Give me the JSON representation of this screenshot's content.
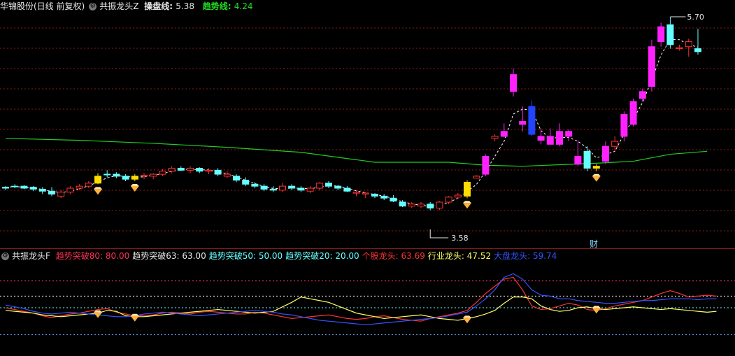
{
  "top": {
    "stock": "华锦股份(日线 前复权)",
    "indicator": "共振龙头Z",
    "cp_label": "操盘线: ",
    "cp_value": "5.38",
    "trend_label": "趋势线: ",
    "trend_value": "4.24",
    "high_mark": "5.70",
    "low_mark": "3.58",
    "fin_label": "财"
  },
  "bottom": {
    "indicator": "共振龙头F",
    "items": [
      {
        "label": "趋势突破80: ",
        "value": "80.00",
        "color": "#ff3355"
      },
      {
        "label": "趋势突破63: ",
        "value": "63.00",
        "color": "#e6e6e6"
      },
      {
        "label": "趋势突破50: ",
        "value": "50.00",
        "color": "#66ffff"
      },
      {
        "label": "趋势突破20: ",
        "value": "20.00",
        "color": "#66ffff"
      },
      {
        "label": "个股龙头: ",
        "value": "63.69",
        "color": "#ff3333"
      },
      {
        "label": "行业龙头: ",
        "value": "47.52",
        "color": "#ffff66"
      },
      {
        "label": "大盘龙头: ",
        "value": "59.74",
        "color": "#3355ff"
      }
    ]
  },
  "colors": {
    "up": "#ff3333",
    "down": "#66ffff",
    "magenta": "#ff22ff",
    "yellow": "#ffdd00",
    "blue": "#2244ff",
    "ma": "#22cc22",
    "cp": "#ffffff",
    "grid": "#8b1a1a"
  },
  "chart_data": {
    "type": "candlestick",
    "candles": [
      [
        3.98,
        4.0,
        3.96,
        3.99,
        "down"
      ],
      [
        4.0,
        4.02,
        3.98,
        4.0,
        "down"
      ],
      [
        4.0,
        4.01,
        3.97,
        3.98,
        "down"
      ],
      [
        3.99,
        4.0,
        3.95,
        3.97,
        "down"
      ],
      [
        3.97,
        3.99,
        3.92,
        3.95,
        "down"
      ],
      [
        3.95,
        3.99,
        3.9,
        3.92,
        "down"
      ],
      [
        3.9,
        3.96,
        3.88,
        3.94,
        "up"
      ],
      [
        3.94,
        4.0,
        3.92,
        3.98,
        "up"
      ],
      [
        3.98,
        4.02,
        3.96,
        4.0,
        "up"
      ],
      [
        4.0,
        4.05,
        3.98,
        4.03,
        "up"
      ],
      [
        4.03,
        4.13,
        4.02,
        4.1,
        "yellow"
      ],
      [
        4.12,
        4.16,
        4.09,
        4.12,
        "down"
      ],
      [
        4.12,
        4.14,
        4.08,
        4.1,
        "down"
      ],
      [
        4.1,
        4.12,
        4.05,
        4.07,
        "down"
      ],
      [
        4.07,
        4.12,
        4.05,
        4.1,
        "yellow"
      ],
      [
        4.1,
        4.13,
        4.07,
        4.11,
        "up"
      ],
      [
        4.1,
        4.13,
        4.07,
        4.12,
        "up"
      ],
      [
        4.12,
        4.17,
        4.1,
        4.15,
        "up"
      ],
      [
        4.15,
        4.2,
        4.13,
        4.18,
        "up"
      ],
      [
        4.18,
        4.2,
        4.15,
        4.16,
        "down"
      ],
      [
        4.16,
        4.2,
        4.13,
        4.18,
        "up"
      ],
      [
        4.18,
        4.19,
        4.13,
        4.15,
        "down"
      ],
      [
        4.15,
        4.18,
        4.12,
        4.16,
        "up"
      ],
      [
        4.16,
        4.18,
        4.1,
        4.12,
        "down"
      ],
      [
        4.12,
        4.15,
        4.08,
        4.1,
        "up"
      ],
      [
        4.1,
        4.12,
        4.04,
        4.06,
        "down"
      ],
      [
        4.06,
        4.09,
        4.0,
        4.02,
        "down"
      ],
      [
        4.02,
        4.04,
        3.98,
        4.0,
        "down"
      ],
      [
        4.0,
        4.02,
        3.95,
        3.97,
        "down"
      ],
      [
        3.97,
        4.0,
        3.94,
        3.96,
        "down"
      ],
      [
        3.96,
        4.03,
        3.94,
        4.0,
        "up"
      ],
      [
        4.0,
        4.02,
        3.96,
        3.98,
        "down"
      ],
      [
        3.98,
        4.0,
        3.94,
        3.96,
        "down"
      ],
      [
        3.95,
        4.0,
        3.93,
        3.98,
        "up"
      ],
      [
        3.98,
        4.04,
        3.96,
        4.03,
        "up"
      ],
      [
        4.03,
        4.05,
        3.98,
        4.0,
        "down"
      ],
      [
        4.0,
        4.01,
        3.96,
        3.98,
        "down"
      ],
      [
        3.98,
        4.0,
        3.94,
        3.95,
        "down"
      ],
      [
        3.94,
        3.96,
        3.9,
        3.93,
        "up"
      ],
      [
        3.93,
        3.94,
        3.88,
        3.92,
        "up"
      ],
      [
        3.92,
        3.93,
        3.88,
        3.9,
        "down"
      ],
      [
        3.9,
        3.92,
        3.86,
        3.88,
        "down"
      ],
      [
        3.88,
        3.91,
        3.84,
        3.85,
        "down"
      ],
      [
        3.84,
        3.86,
        3.79,
        3.8,
        "down"
      ],
      [
        3.8,
        3.84,
        3.78,
        3.82,
        "up"
      ],
      [
        3.82,
        3.84,
        3.78,
        3.8,
        "up"
      ],
      [
        3.82,
        3.84,
        3.76,
        3.78,
        "down"
      ],
      [
        3.78,
        3.85,
        3.76,
        3.84,
        "up"
      ],
      [
        3.84,
        3.9,
        3.82,
        3.89,
        "up"
      ],
      [
        3.89,
        3.93,
        3.87,
        3.91,
        "up"
      ],
      [
        3.9,
        4.06,
        3.88,
        4.04,
        "yellow"
      ],
      [
        4.08,
        4.11,
        4.08,
        4.1,
        "up"
      ],
      [
        4.12,
        4.32,
        4.1,
        4.3,
        "magenta"
      ],
      [
        4.48,
        4.52,
        4.45,
        4.5,
        "up"
      ],
      [
        4.5,
        4.63,
        4.49,
        4.55,
        "magenta"
      ],
      [
        4.95,
        5.18,
        4.9,
        5.12,
        "magenta"
      ],
      [
        4.62,
        4.8,
        4.55,
        4.65,
        "magenta"
      ],
      [
        4.8,
        4.86,
        4.5,
        4.52,
        "blue"
      ],
      [
        4.46,
        4.58,
        4.42,
        4.5,
        "magenta"
      ],
      [
        4.5,
        4.58,
        4.42,
        4.42,
        "magenta"
      ],
      [
        4.42,
        4.63,
        4.4,
        4.55,
        "magenta"
      ],
      [
        4.55,
        4.57,
        4.45,
        4.5,
        "magenta"
      ],
      [
        4.22,
        4.46,
        4.2,
        4.3,
        "magenta"
      ],
      [
        4.18,
        4.4,
        4.15,
        4.35,
        "down"
      ],
      [
        4.18,
        4.22,
        4.15,
        4.2,
        "yellow"
      ],
      [
        4.25,
        4.45,
        4.22,
        4.4,
        "magenta"
      ],
      [
        4.4,
        4.5,
        4.35,
        4.45,
        "up"
      ],
      [
        4.5,
        4.75,
        4.45,
        4.72,
        "magenta"
      ],
      [
        4.62,
        4.88,
        4.6,
        4.85,
        "magenta"
      ],
      [
        4.88,
        4.98,
        4.85,
        4.95,
        "magenta"
      ],
      [
        5.0,
        5.47,
        4.95,
        5.4,
        "magenta"
      ],
      [
        5.45,
        5.64,
        5.4,
        5.6,
        "magenta"
      ],
      [
        5.62,
        5.7,
        5.38,
        5.42,
        "down"
      ],
      [
        5.38,
        5.42,
        5.36,
        5.39,
        "up"
      ],
      [
        5.4,
        5.48,
        5.3,
        5.45,
        "up"
      ],
      [
        5.38,
        5.58,
        5.32,
        5.35,
        "down"
      ]
    ],
    "ma_points": [
      [
        0,
        4.48
      ],
      [
        8,
        4.46
      ],
      [
        16,
        4.43
      ],
      [
        24,
        4.39
      ],
      [
        32,
        4.34
      ],
      [
        40,
        4.24
      ],
      [
        48,
        4.24
      ],
      [
        52,
        4.21
      ],
      [
        56,
        4.2
      ],
      [
        64,
        4.23
      ],
      [
        68,
        4.25
      ],
      [
        72,
        4.32
      ],
      [
        76,
        4.35
      ]
    ],
    "y_range": [
      3.58,
      5.7
    ],
    "signal_candles": [
      10,
      14,
      50,
      64
    ],
    "lower": {
      "y_range": [
        0,
        100
      ],
      "thresholds": [
        80,
        63,
        50,
        20
      ],
      "series": [
        {
          "name": "个股龙头",
          "color": "#ff3333",
          "values": [
            50,
            48,
            46,
            44,
            41,
            39,
            41,
            43,
            44,
            46,
            48,
            49,
            45,
            43,
            41,
            41,
            42,
            44,
            45,
            44,
            43,
            45,
            46,
            45,
            44,
            43,
            43,
            45,
            44,
            42,
            40,
            38,
            39,
            40,
            41,
            42,
            40,
            38,
            37,
            38,
            40,
            41,
            39,
            37,
            36,
            35,
            38,
            40,
            42,
            44,
            47,
            56,
            66,
            74,
            82,
            84,
            70,
            52,
            48,
            49,
            52,
            55,
            53,
            48,
            47,
            49,
            52,
            54,
            56,
            58,
            62,
            66,
            69,
            66,
            62,
            63,
            64,
            63
          ]
        },
        {
          "name": "行业龙头",
          "color": "#ffff66",
          "values": [
            47,
            46,
            45,
            44,
            42,
            41,
            40,
            41,
            42,
            43,
            44,
            47,
            46,
            41,
            40,
            40,
            41,
            42,
            43,
            44,
            45,
            46,
            47,
            48,
            47,
            46,
            45,
            44,
            45,
            46,
            51,
            56,
            62,
            60,
            58,
            56,
            52,
            48,
            44,
            42,
            40,
            38,
            39,
            40,
            41,
            42,
            40,
            38,
            37,
            36,
            38,
            40,
            43,
            47,
            55,
            62,
            62,
            60,
            52,
            48,
            46,
            47,
            50,
            51,
            49,
            48,
            49,
            50,
            51,
            50,
            49,
            48,
            49,
            48,
            47,
            46,
            45,
            46
          ]
        },
        {
          "name": "大盘龙头",
          "color": "#3355ff",
          "values": [
            53,
            51,
            49,
            46,
            44,
            43,
            44,
            45,
            44,
            43,
            42,
            41,
            40,
            40,
            41,
            43,
            44,
            45,
            44,
            43,
            42,
            41,
            42,
            43,
            44,
            45,
            46,
            47,
            46,
            45,
            43,
            42,
            40,
            38,
            36,
            35,
            34,
            33,
            32,
            31,
            32,
            33,
            34,
            35,
            36,
            37,
            38,
            39,
            41,
            43,
            45,
            52,
            60,
            70,
            84,
            88,
            82,
            70,
            64,
            63,
            60,
            60,
            58,
            57,
            56,
            55,
            55,
            56,
            57,
            58,
            58,
            59,
            60,
            60,
            60,
            59,
            60,
            60
          ]
        }
      ]
    }
  }
}
